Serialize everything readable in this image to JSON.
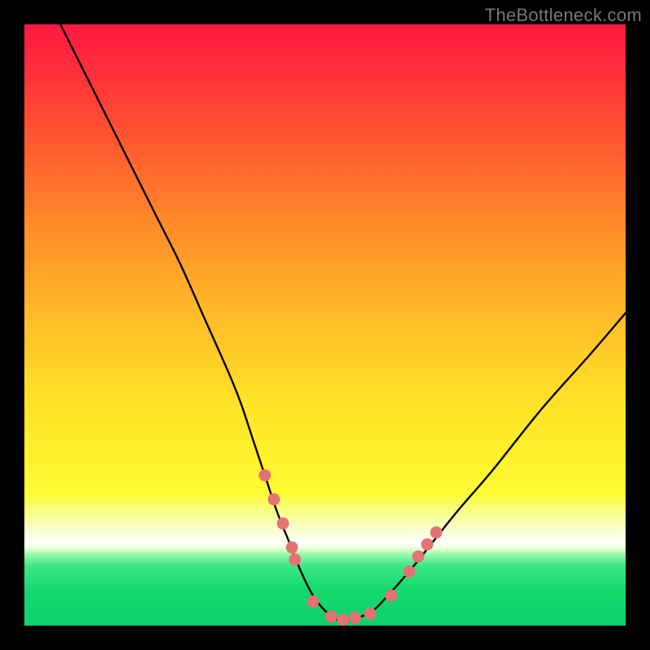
{
  "watermark": "TheBottleneck.com",
  "colors": {
    "dot": "#e57373",
    "curve": "#000000"
  },
  "chart_data": {
    "type": "line",
    "title": "",
    "xlabel": "",
    "ylabel": "",
    "xlim": [
      0,
      100
    ],
    "ylim": [
      0,
      100
    ],
    "grid": false,
    "legend": false,
    "series": [
      {
        "name": "bottleneck-curve",
        "x": [
          6,
          10,
          14,
          18,
          22,
          26,
          30,
          34,
          36,
          38,
          40,
          42,
          44,
          46,
          48,
          50,
          52,
          54,
          56,
          58,
          60,
          64,
          68,
          72,
          78,
          86,
          94,
          100
        ],
        "y": [
          100,
          92,
          84,
          76,
          68,
          60,
          51,
          42,
          37,
          31,
          25,
          19,
          14,
          9,
          5,
          2.5,
          1,
          1,
          1.5,
          2.5,
          4.5,
          9,
          14,
          19,
          26,
          36,
          45,
          52
        ]
      }
    ],
    "dots": {
      "name": "highlight-dots",
      "x": [
        40,
        41.5,
        43,
        44.5,
        45,
        48,
        51,
        53,
        55,
        57.5,
        61,
        64,
        65.5,
        67,
        68.5
      ],
      "y": [
        25,
        21,
        17,
        13,
        11,
        4,
        1.5,
        1,
        1.3,
        2,
        5,
        9,
        11.5,
        13.5,
        15.5
      ]
    }
  }
}
